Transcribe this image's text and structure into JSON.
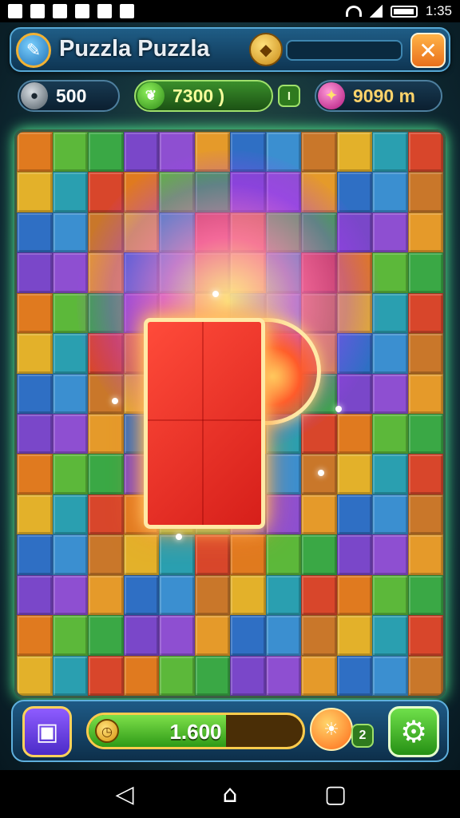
{
  "status": {
    "time": "1:35"
  },
  "header": {
    "title": "Puzzla Puzzla",
    "close_label": "✕"
  },
  "stats": {
    "coins": "500",
    "score": "7300 )",
    "badge": "I",
    "distance": "9090 m"
  },
  "bottom": {
    "progress_value": "1.600",
    "progress_fraction": 0.64,
    "bonus_count": "2"
  },
  "colors": {
    "accent": "#2e9a17",
    "piece": "#e0261f",
    "frame": "#1e5a86"
  },
  "icons": {
    "app": "brush-icon",
    "badge": "gem-icon",
    "close": "close-icon",
    "coins": "coin-icon",
    "score": "leaf-icon",
    "distance": "wand-icon",
    "box": "box-icon",
    "clock": "clock-icon",
    "bonus": "sun-icon",
    "settings": "gear-icon"
  },
  "nav": {
    "back": "◁",
    "home": "⌂",
    "recent": "▢"
  }
}
